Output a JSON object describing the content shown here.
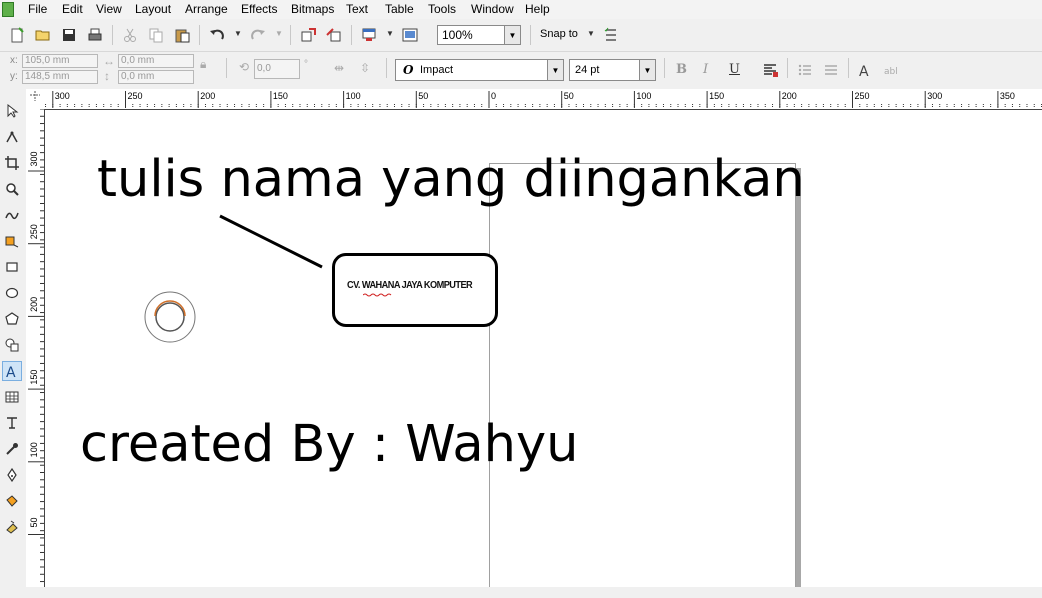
{
  "menu": {
    "items": [
      "File",
      "Edit",
      "View",
      "Layout",
      "Arrange",
      "Effects",
      "Bitmaps",
      "Text",
      "Table",
      "Tools",
      "Window",
      "Help"
    ]
  },
  "toolbar": {
    "zoom_value": "100%",
    "snap_label": "Snap to"
  },
  "property_bar": {
    "x_label": "x:",
    "y_label": "y:",
    "x_value": "105,0 mm",
    "y_value": "148,5 mm",
    "width_value": "0,0 mm",
    "height_value": "0,0 mm",
    "angle_value": "0,0",
    "angle_unit": "°",
    "font_name": "Impact",
    "font_size": "24 pt"
  },
  "ruler": {
    "horizontal_labels": [
      "300",
      "250",
      "200",
      "150",
      "100",
      "50",
      "0",
      "50",
      "100",
      "150",
      "200",
      "250",
      "300",
      "350"
    ],
    "vertical_labels": [
      "300",
      "250",
      "200",
      "150",
      "100",
      "50"
    ]
  },
  "canvas": {
    "annotation_top": "tulis nama yang diingankan",
    "callout_text": "CV. WAHANA JAYA KOMPUTER",
    "annotation_bottom": "created By : Wahyu"
  },
  "colors": {
    "callout_border": "#000000",
    "page_shadow": "#a8a8a8",
    "active_tool": "#cfe4f7"
  }
}
